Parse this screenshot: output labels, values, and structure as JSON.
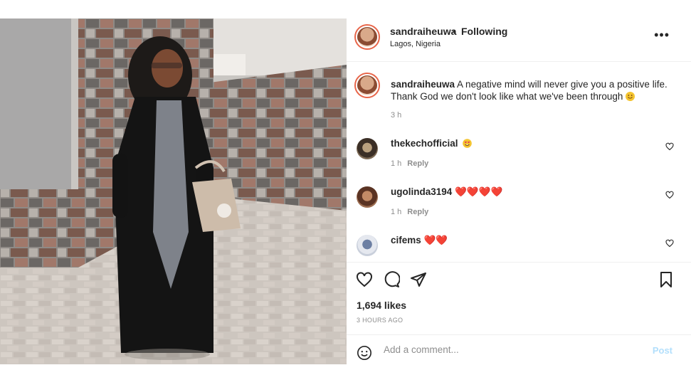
{
  "post": {
    "username": "sandraiheuwa",
    "separator": "•",
    "follow_status": "Following",
    "location": "Lagos, Nigeria",
    "more_label": "•••",
    "photo_icon": "portrait-photo"
  },
  "caption": {
    "username": "sandraiheuwa",
    "text": "A negative mind will never give you a positive life. Thank God we don't look like what we've been through",
    "emoji": "grinning-face-emoji",
    "age": "3 h"
  },
  "comments": [
    {
      "username": "thekechofficial",
      "emoji": "heart-eyes-emoji",
      "age": "1 h",
      "reply_label": "Reply",
      "like_icon": "heart-outline-icon"
    },
    {
      "username": "ugolinda3194",
      "emoji_text": "❤️❤️❤️❤️",
      "age": "1 h",
      "reply_label": "Reply",
      "like_icon": "heart-outline-icon"
    },
    {
      "username": "cifems",
      "emoji_text": "❤️❤️",
      "like_icon": "heart-outline-icon"
    }
  ],
  "actions": {
    "like_icon": "heart-outline-icon",
    "comment_icon": "comment-bubble-icon",
    "share_icon": "paper-plane-icon",
    "save_icon": "bookmark-icon"
  },
  "likes_text": "1,694 likes",
  "posted_time": "3 HOURS AGO",
  "add_comment": {
    "placeholder": "Add a comment...",
    "post_label": "Post",
    "emoji_icon": "smiley-icon"
  },
  "colors": {
    "text": "#262626",
    "secondary": "#8e8e8e",
    "link_disabled": "#b2dffc",
    "story_ring": "#e8664a",
    "heart_emoji": "#ed4956"
  }
}
